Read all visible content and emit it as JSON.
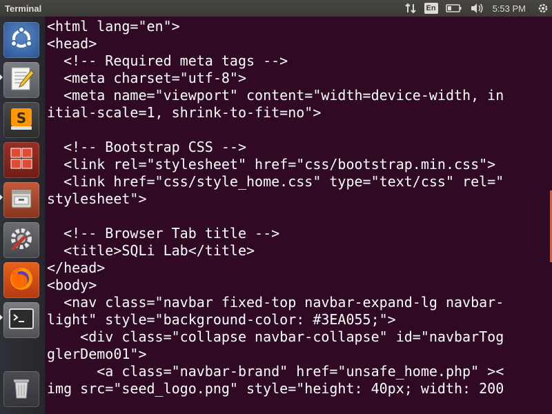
{
  "top_panel": {
    "title": "Terminal",
    "keyboard_layout": "En",
    "clock": "5:53 PM"
  },
  "launcher": {
    "items": [
      {
        "name": "ubuntu-dash-icon"
      },
      {
        "name": "text-editor-icon"
      },
      {
        "name": "sublime-text-icon"
      },
      {
        "name": "workspace-switcher-icon"
      },
      {
        "name": "file-manager-icon"
      },
      {
        "name": "system-settings-icon"
      },
      {
        "name": "firefox-icon"
      },
      {
        "name": "terminal-app-icon"
      },
      {
        "name": "trash-icon"
      }
    ]
  },
  "terminal": {
    "lines": [
      "<html lang=\"en\">",
      "<head>",
      "  <!-- Required meta tags -->",
      "  <meta charset=\"utf-8\">",
      "  <meta name=\"viewport\" content=\"width=device-width, in",
      "itial-scale=1, shrink-to-fit=no\">",
      "",
      "  <!-- Bootstrap CSS -->",
      "  <link rel=\"stylesheet\" href=\"css/bootstrap.min.css\">",
      "  <link href=\"css/style_home.css\" type=\"text/css\" rel=\"",
      "stylesheet\">",
      "",
      "  <!-- Browser Tab title -->",
      "  <title>SQLi Lab</title>",
      "</head>",
      "<body>",
      "  <nav class=\"navbar fixed-top navbar-expand-lg navbar-",
      "light\" style=\"background-color: #3EA055;\">",
      "    <div class=\"collapse navbar-collapse\" id=\"navbarTog",
      "glerDemo01\">",
      "      <a class=\"navbar-brand\" href=\"unsafe_home.php\" ><",
      "img src=\"seed_logo.png\" style=\"height: 40px; width: 200"
    ]
  },
  "colors": {
    "terminal_bg": "#300a24",
    "panel_bg": "#3c3b37",
    "launcher_bg": "#2a2a31",
    "accent": "#e35b2d"
  }
}
